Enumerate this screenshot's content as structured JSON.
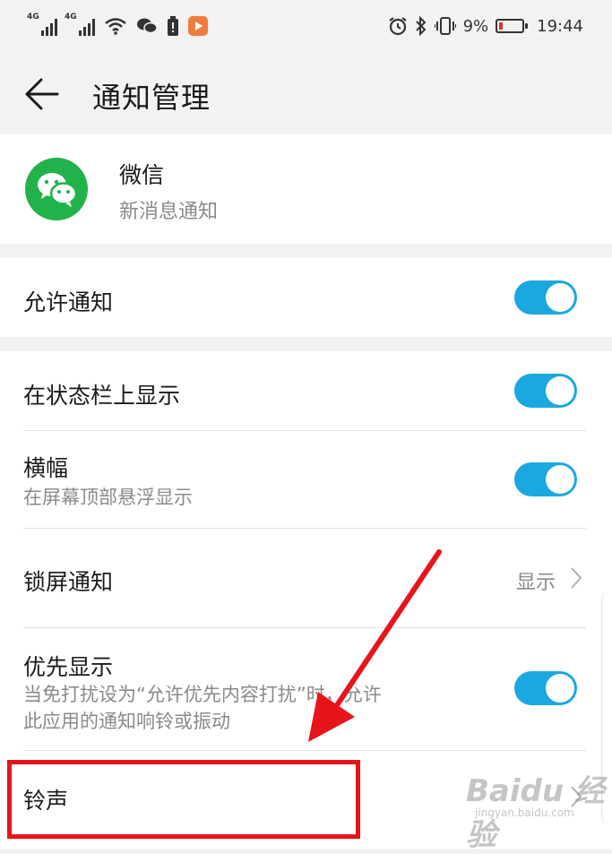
{
  "status_bar": {
    "net1": "4G",
    "net2": "4G",
    "battery_percent": "9%",
    "time": "19:44",
    "icons": [
      "signal-icon",
      "signal-icon",
      "wifi-icon",
      "wechat-icon",
      "battery-saver-icon",
      "video-app-icon",
      "alarm-icon",
      "bluetooth-icon",
      "vibrate-icon",
      "battery-icon"
    ]
  },
  "header": {
    "title": "通知管理"
  },
  "app": {
    "name": "微信",
    "subtitle": "新消息通知"
  },
  "settings": {
    "allow_notifications": {
      "label": "允许通知",
      "enabled": true
    },
    "status_bar_display": {
      "label": "在状态栏上显示",
      "enabled": true
    },
    "banner": {
      "label": "横幅",
      "description": "在屏幕顶部悬浮显示",
      "enabled": true
    },
    "lock_screen": {
      "label": "锁屏通知",
      "value": "显示"
    },
    "priority": {
      "label": "优先显示",
      "description_line1": "当免打扰设为“允许优先内容打扰”时，允许",
      "description_line2": "此应用的通知响铃或振动",
      "enabled": true
    },
    "ringtone": {
      "label": "铃声"
    }
  },
  "watermark": {
    "brand": "Baidu 经验",
    "url": "jingyan.baidu.com"
  },
  "colors": {
    "toggle_on": "#1aa8e0",
    "wechat_green": "#22b24c",
    "annotation_red": "#e8141c"
  }
}
